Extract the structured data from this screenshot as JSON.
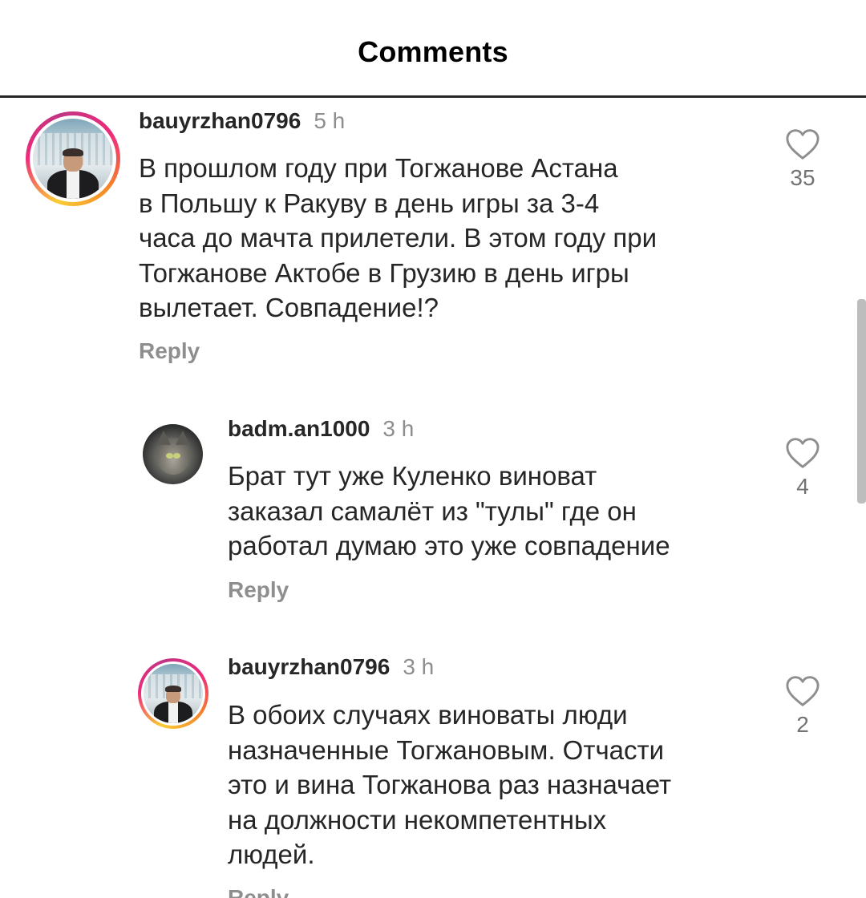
{
  "header": {
    "title": "Comments"
  },
  "comments": [
    {
      "username": "bauyrzhan0796",
      "time": "5 h",
      "text": "В прошлом году при Тогжанове Астана\nв Польшу к Ракуву в день игры за 3-4\nчаса до мачта прилетели. В этом году при\nТогжанове Актобе в Грузию в день игры\nвылетает. Совпадение!?",
      "reply_label": "Reply",
      "likes": "35",
      "avatar_icon": "profile-photo-story-ring"
    },
    {
      "username": "badm.an1000",
      "time": "3 h",
      "text": "Брат тут уже Куленко виноват\nзаказал самалёт из \"тулы\" где он\nработал думаю это уже совпадение",
      "reply_label": "Reply",
      "likes": "4",
      "avatar_icon": "cat-profile-photo"
    },
    {
      "username": "bauyrzhan0796",
      "time": "3 h",
      "text": "В обоих случаях виноваты люди\nназначенные Тогжановым. Отчасти\nэто и вина Тогжанова раз назначает\nна должности некомпетентных\nлюдей.",
      "reply_label": "Reply",
      "likes": "2",
      "avatar_icon": "profile-photo-story-ring"
    }
  ],
  "icons": {
    "like": "heart-outline-icon"
  },
  "colors": {
    "story_ring_start": "#f9ce34",
    "story_ring_mid": "#ee2a7b",
    "story_ring_end": "#c13584",
    "muted_text": "#8e8e8e"
  }
}
